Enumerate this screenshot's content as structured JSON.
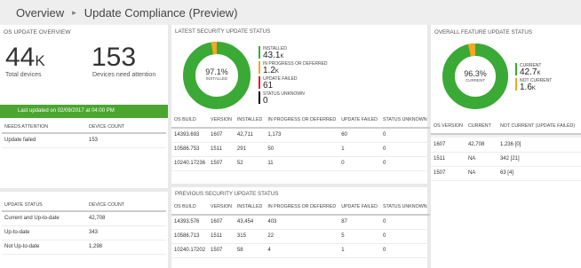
{
  "breadcrumb": {
    "root": "Overview",
    "separator": "▸",
    "current": "Update Compliance (Preview)"
  },
  "os_overview": {
    "title": "OS UPDATE OVERVIEW",
    "total_devices": {
      "value": "44",
      "unit": "K",
      "label": "Total devices"
    },
    "need_attention": {
      "value": "153",
      "label": "Devices need attention"
    },
    "last_updated": "Last updated on 02/09/2017 at 04:00 PM",
    "attention_table": {
      "headers": [
        "NEEDS ATTENTION",
        "DEVICE COUNT"
      ],
      "rows": [
        [
          "Update failed",
          "153"
        ]
      ]
    },
    "status_table": {
      "headers": [
        "UPDATE STATUS",
        "DEVICE COUNT"
      ],
      "rows": [
        [
          "Current and Up-to-date",
          "42,708"
        ],
        [
          "Up-to-date",
          "343"
        ],
        [
          "Not Up-to-date",
          "1,298"
        ]
      ]
    }
  },
  "security": {
    "title": "LATEST SECURITY UPDATE STATUS",
    "donut": {
      "percent_label": "97.1%",
      "center_label": "INSTALLED",
      "fraction": 0.971
    },
    "legend": [
      {
        "label": "INSTALLED",
        "value": "43.1",
        "unit": "K",
        "color": "#3aa935"
      },
      {
        "label": "IN PROGRESS OR DEFERRED",
        "value": "1.2",
        "unit": "K",
        "color": "#f5a623"
      },
      {
        "label": "UPDATE FAILED",
        "value": "61",
        "unit": "",
        "color": "#e81123"
      },
      {
        "label": "STATUS UNKNOWN",
        "value": "0",
        "unit": "",
        "color": "#000000"
      }
    ],
    "headers": [
      "OS BUILD",
      "VERSION",
      "INSTALLED",
      "IN PROGRESS OR DEFERRED",
      "UPDATE FAILED",
      "STATUS UNKNOWN"
    ],
    "rows": [
      [
        "14393.693",
        "1607",
        "42,711",
        "1,173",
        "60",
        "0"
      ],
      [
        "10586.753",
        "1511",
        "291",
        "50",
        "1",
        "0"
      ],
      [
        "10240.17236",
        "1507",
        "52",
        "11",
        "0",
        "0"
      ]
    ],
    "previous_title": "PREVIOUS SECURITY UPDATE STATUS",
    "previous_rows": [
      [
        "14393.576",
        "1607",
        "43,454",
        "403",
        "87",
        "0"
      ],
      [
        "10586.713",
        "1511",
        "315",
        "22",
        "5",
        "0"
      ],
      [
        "10240.17202",
        "1507",
        "58",
        "4",
        "1",
        "0"
      ]
    ]
  },
  "feature": {
    "title": "OVERALL FEATURE UPDATE STATUS",
    "donut": {
      "percent_label": "96.3%",
      "center_label": "CURRENT",
      "fraction": 0.963
    },
    "legend": [
      {
        "label": "CURRENT",
        "value": "42.7",
        "unit": "K",
        "color": "#3aa935"
      },
      {
        "label": "NOT CURRENT",
        "value": "1.6",
        "unit": "K",
        "color": "#f5a623"
      }
    ],
    "headers": [
      "OS VERSION",
      "CURRENT",
      "NOT CURRENT (UPDATE FAILED)"
    ],
    "rows": [
      [
        "1607",
        "42,708",
        "1,236 [0]"
      ],
      [
        "1511",
        "NA",
        "342 [21]"
      ],
      [
        "1507",
        "NA",
        "63 [4]"
      ]
    ]
  },
  "colors": {
    "installed": "#3aa935",
    "in_progress": "#f5a623",
    "failed": "#e81123",
    "unknown": "#000000",
    "accent_green": "#4aa62e"
  }
}
